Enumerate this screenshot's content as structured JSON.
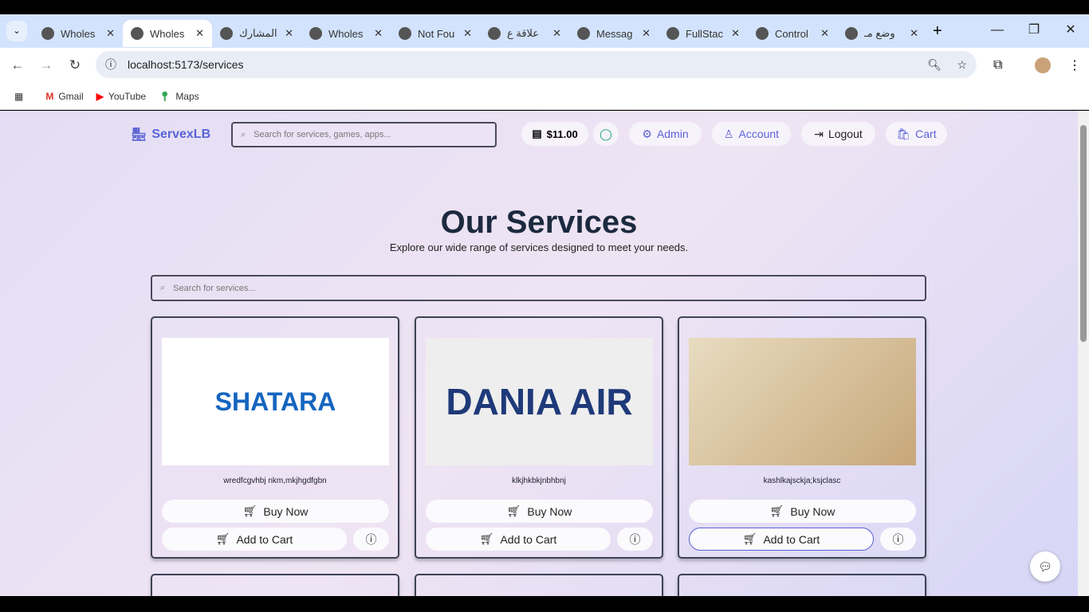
{
  "browser": {
    "tabs": [
      "Wholes",
      "Wholes",
      "المشارك",
      "Wholes",
      "Not Fou",
      "علاقة ع",
      "Messag",
      "FullStac",
      "Control",
      "وضع مـ"
    ],
    "active_tab": 1,
    "url": "localhost:5173/services",
    "bookmarks": [
      "Gmail",
      "YouTube",
      "Maps"
    ]
  },
  "header": {
    "brand": "ServexLB",
    "search_placeholder": "Search for services, games, apps...",
    "balance": "$11.00",
    "admin": "Admin",
    "account": "Account",
    "logout": "Logout",
    "cart": "Cart"
  },
  "main": {
    "title": "Our Services",
    "subtitle": "Explore our wide range of services designed to meet your needs.",
    "search_placeholder": "Search for services...",
    "cards": [
      {
        "image_text": "SHATARA",
        "description": "wredfcgvhbj nkm,mkjhgdfgbn"
      },
      {
        "image_text": "DANIA AIR",
        "description": "klkjhkbkjnbhbnj"
      },
      {
        "image_text": "",
        "description": "kashlkajsckja;ksjclasc"
      }
    ],
    "buy_label": "Buy Now",
    "cart_label": "Add to Cart"
  }
}
